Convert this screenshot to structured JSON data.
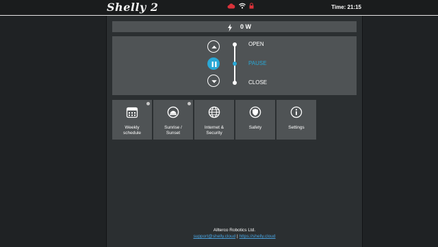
{
  "header": {
    "logo": "Shelly 2",
    "time": "Time: 21:15",
    "status_icons": [
      "cloud-icon",
      "wifi-icon",
      "lock-icon"
    ],
    "colors": {
      "cloud": "#d9323a",
      "wifi": "#ffffff",
      "lock": "#d9323a"
    }
  },
  "power": {
    "value": "0 W"
  },
  "roller": {
    "open_label": "OPEN",
    "pause_label": "PAUSE",
    "close_label": "CLOSE",
    "active": "PAUSE",
    "accent": "#29a8d6"
  },
  "tiles": [
    {
      "label": "Weekly\nschedule",
      "icon": "calendar-icon",
      "indicator": true
    },
    {
      "label": "Sunrise /\nSunset",
      "icon": "sunrise-icon",
      "indicator": true
    },
    {
      "label": "Internet &\nSecurity",
      "icon": "globe-icon",
      "indicator": false
    },
    {
      "label": "Safety",
      "icon": "shield-icon",
      "indicator": false
    },
    {
      "label": "Settings",
      "icon": "info-icon",
      "indicator": false
    }
  ],
  "footer": {
    "company": "Allterco Robotics Ltd.",
    "email": "support@shelly.cloud",
    "separator": "|",
    "site": "https://shelly.cloud"
  }
}
